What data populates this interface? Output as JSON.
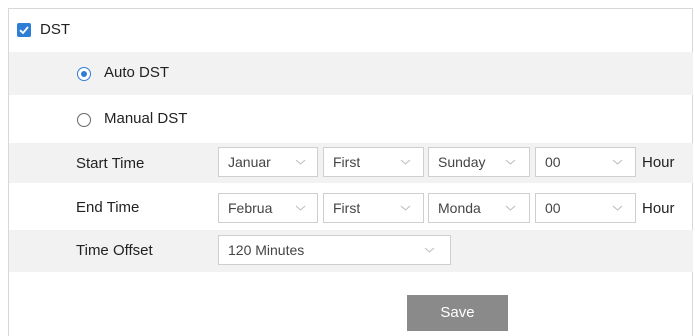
{
  "dst": {
    "label": "DST",
    "checked": true,
    "accent": "#2e7ed6"
  },
  "mode": {
    "auto_label": "Auto DST",
    "manual_label": "Manual DST",
    "selected": "auto"
  },
  "start_time": {
    "label": "Start Time",
    "month": "Januar",
    "week": "First",
    "day": "Sunday",
    "hour": "00",
    "hour_unit": "Hour"
  },
  "end_time": {
    "label": "End Time",
    "month": "Februa",
    "week": "First",
    "day": "Monda",
    "hour": "00",
    "hour_unit": "Hour"
  },
  "time_offset": {
    "label": "Time Offset",
    "value": "120 Minutes"
  },
  "actions": {
    "save_label": "Save",
    "save_color": "#8a8a8a"
  },
  "icons": {
    "checkbox": "checkmark-icon",
    "dropdown": "chevron-down-icon"
  }
}
